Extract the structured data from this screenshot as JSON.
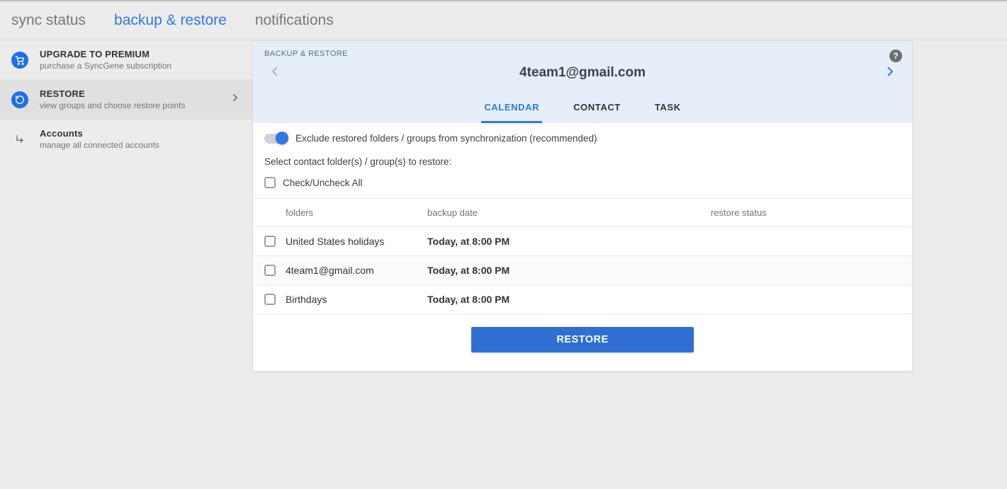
{
  "topnav": {
    "sync_status": "sync status",
    "backup_restore": "backup & restore",
    "notifications": "notifications"
  },
  "sidebar": {
    "premium": {
      "title": "UPGRADE TO PREMIUM",
      "sub": "purchase a SyncGene subscription"
    },
    "restore": {
      "title": "RESTORE",
      "sub": "view groups and choose restore points"
    },
    "accounts": {
      "title": "Accounts",
      "sub": "manage all connected accounts"
    }
  },
  "card": {
    "crumb": "BACKUP & RESTORE",
    "email": "4team1@gmail.com",
    "subtabs": {
      "calendar": "CALENDAR",
      "contact": "CONTACT",
      "task": "TASK"
    },
    "toggle_label": "Exclude restored folders / groups from synchronization (recommended)",
    "instruction": "Select contact folder(s) / group(s) to restore:",
    "check_all": "Check/Uncheck All",
    "headers": {
      "folders": "folders",
      "backup_date": "backup date",
      "restore_status": "restore status"
    },
    "rows": [
      {
        "folder": "United States holidays",
        "date": "Today, at 8:00 PM"
      },
      {
        "folder": "4team1@gmail.com",
        "date": "Today, at 8:00 PM"
      },
      {
        "folder": "Birthdays",
        "date": "Today, at 8:00 PM"
      }
    ],
    "restore_button": "RESTORE",
    "help_tooltip": "?"
  }
}
